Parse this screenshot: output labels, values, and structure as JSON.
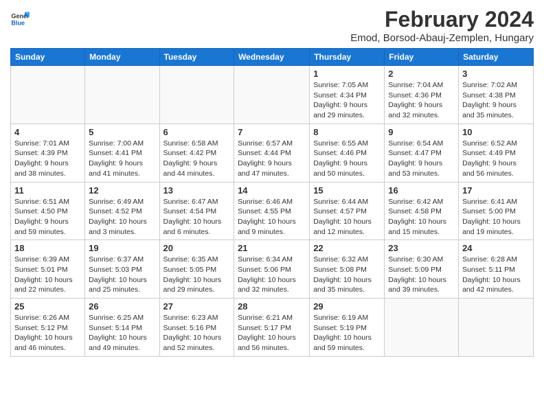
{
  "logo": {
    "line1": "General",
    "line2": "Blue"
  },
  "title": "February 2024",
  "subtitle": "Emod, Borsod-Abauj-Zemplen, Hungary",
  "days_of_week": [
    "Sunday",
    "Monday",
    "Tuesday",
    "Wednesday",
    "Thursday",
    "Friday",
    "Saturday"
  ],
  "weeks": [
    [
      {
        "day": "",
        "info": ""
      },
      {
        "day": "",
        "info": ""
      },
      {
        "day": "",
        "info": ""
      },
      {
        "day": "",
        "info": ""
      },
      {
        "day": "1",
        "info": "Sunrise: 7:05 AM\nSunset: 4:34 PM\nDaylight: 9 hours and 29 minutes."
      },
      {
        "day": "2",
        "info": "Sunrise: 7:04 AM\nSunset: 4:36 PM\nDaylight: 9 hours and 32 minutes."
      },
      {
        "day": "3",
        "info": "Sunrise: 7:02 AM\nSunset: 4:38 PM\nDaylight: 9 hours and 35 minutes."
      }
    ],
    [
      {
        "day": "4",
        "info": "Sunrise: 7:01 AM\nSunset: 4:39 PM\nDaylight: 9 hours and 38 minutes."
      },
      {
        "day": "5",
        "info": "Sunrise: 7:00 AM\nSunset: 4:41 PM\nDaylight: 9 hours and 41 minutes."
      },
      {
        "day": "6",
        "info": "Sunrise: 6:58 AM\nSunset: 4:42 PM\nDaylight: 9 hours and 44 minutes."
      },
      {
        "day": "7",
        "info": "Sunrise: 6:57 AM\nSunset: 4:44 PM\nDaylight: 9 hours and 47 minutes."
      },
      {
        "day": "8",
        "info": "Sunrise: 6:55 AM\nSunset: 4:46 PM\nDaylight: 9 hours and 50 minutes."
      },
      {
        "day": "9",
        "info": "Sunrise: 6:54 AM\nSunset: 4:47 PM\nDaylight: 9 hours and 53 minutes."
      },
      {
        "day": "10",
        "info": "Sunrise: 6:52 AM\nSunset: 4:49 PM\nDaylight: 9 hours and 56 minutes."
      }
    ],
    [
      {
        "day": "11",
        "info": "Sunrise: 6:51 AM\nSunset: 4:50 PM\nDaylight: 9 hours and 59 minutes."
      },
      {
        "day": "12",
        "info": "Sunrise: 6:49 AM\nSunset: 4:52 PM\nDaylight: 10 hours and 3 minutes."
      },
      {
        "day": "13",
        "info": "Sunrise: 6:47 AM\nSunset: 4:54 PM\nDaylight: 10 hours and 6 minutes."
      },
      {
        "day": "14",
        "info": "Sunrise: 6:46 AM\nSunset: 4:55 PM\nDaylight: 10 hours and 9 minutes."
      },
      {
        "day": "15",
        "info": "Sunrise: 6:44 AM\nSunset: 4:57 PM\nDaylight: 10 hours and 12 minutes."
      },
      {
        "day": "16",
        "info": "Sunrise: 6:42 AM\nSunset: 4:58 PM\nDaylight: 10 hours and 15 minutes."
      },
      {
        "day": "17",
        "info": "Sunrise: 6:41 AM\nSunset: 5:00 PM\nDaylight: 10 hours and 19 minutes."
      }
    ],
    [
      {
        "day": "18",
        "info": "Sunrise: 6:39 AM\nSunset: 5:01 PM\nDaylight: 10 hours and 22 minutes."
      },
      {
        "day": "19",
        "info": "Sunrise: 6:37 AM\nSunset: 5:03 PM\nDaylight: 10 hours and 25 minutes."
      },
      {
        "day": "20",
        "info": "Sunrise: 6:35 AM\nSunset: 5:05 PM\nDaylight: 10 hours and 29 minutes."
      },
      {
        "day": "21",
        "info": "Sunrise: 6:34 AM\nSunset: 5:06 PM\nDaylight: 10 hours and 32 minutes."
      },
      {
        "day": "22",
        "info": "Sunrise: 6:32 AM\nSunset: 5:08 PM\nDaylight: 10 hours and 35 minutes."
      },
      {
        "day": "23",
        "info": "Sunrise: 6:30 AM\nSunset: 5:09 PM\nDaylight: 10 hours and 39 minutes."
      },
      {
        "day": "24",
        "info": "Sunrise: 6:28 AM\nSunset: 5:11 PM\nDaylight: 10 hours and 42 minutes."
      }
    ],
    [
      {
        "day": "25",
        "info": "Sunrise: 6:26 AM\nSunset: 5:12 PM\nDaylight: 10 hours and 46 minutes."
      },
      {
        "day": "26",
        "info": "Sunrise: 6:25 AM\nSunset: 5:14 PM\nDaylight: 10 hours and 49 minutes."
      },
      {
        "day": "27",
        "info": "Sunrise: 6:23 AM\nSunset: 5:16 PM\nDaylight: 10 hours and 52 minutes."
      },
      {
        "day": "28",
        "info": "Sunrise: 6:21 AM\nSunset: 5:17 PM\nDaylight: 10 hours and 56 minutes."
      },
      {
        "day": "29",
        "info": "Sunrise: 6:19 AM\nSunset: 5:19 PM\nDaylight: 10 hours and 59 minutes."
      },
      {
        "day": "",
        "info": ""
      },
      {
        "day": "",
        "info": ""
      }
    ]
  ]
}
